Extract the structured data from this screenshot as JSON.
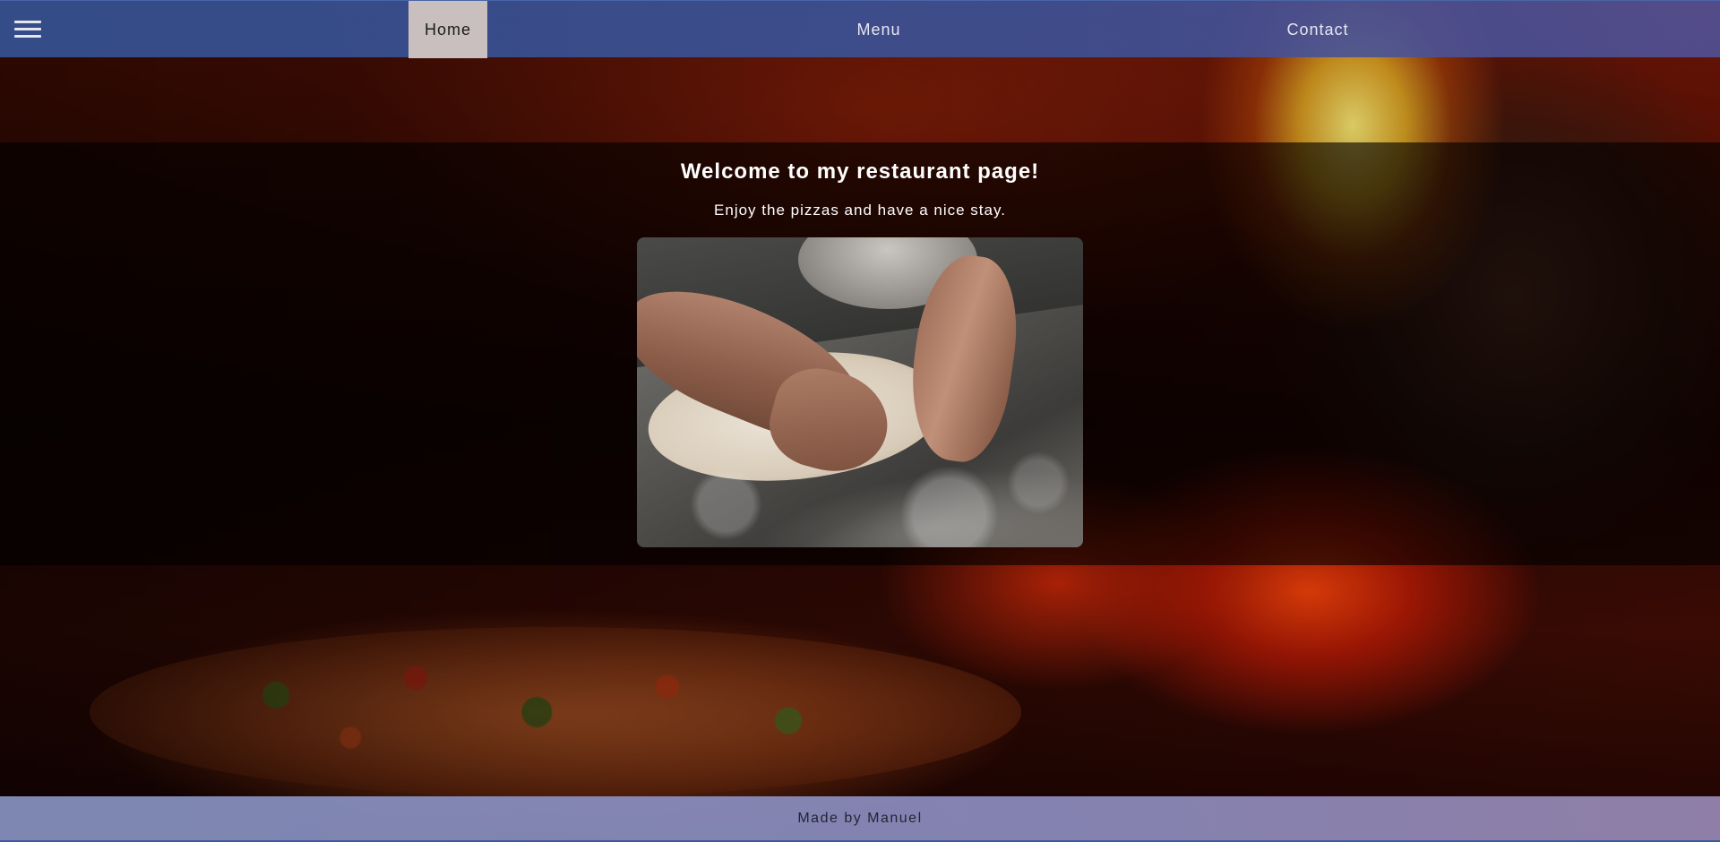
{
  "nav": {
    "items": [
      {
        "label": "Home",
        "active": true
      },
      {
        "label": "Menu",
        "active": false
      },
      {
        "label": "Contact",
        "active": false
      }
    ],
    "menu_icon": "hamburger-menu-icon",
    "active_bg": "#c9bfbf",
    "bar_color": "#344e8c"
  },
  "hero": {
    "title": "Welcome to my restaurant page!",
    "subtitle": "Enjoy the pizzas and have a nice stay."
  },
  "footer": {
    "text": "Made by Manuel"
  }
}
